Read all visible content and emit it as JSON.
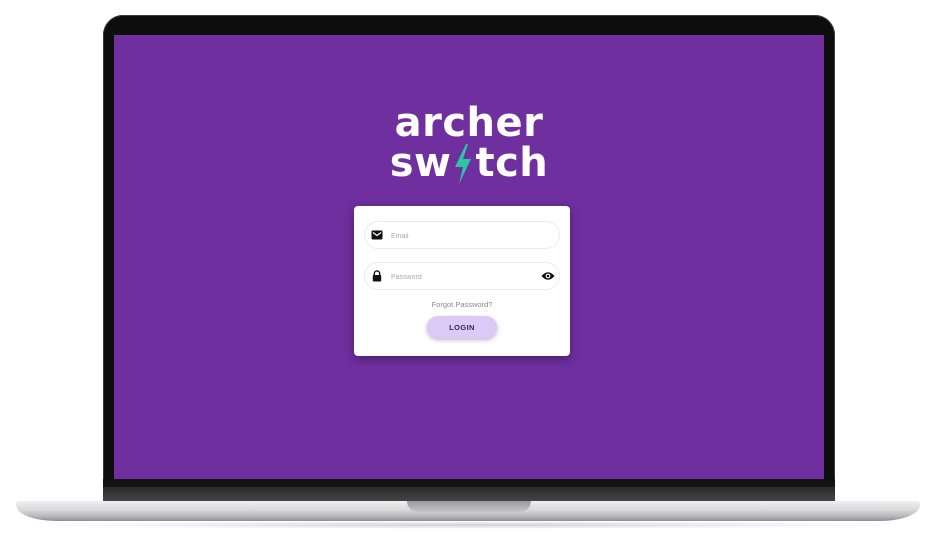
{
  "logo": {
    "line1": "archer",
    "line2_prefix": "sw",
    "line2_suffix": "tch",
    "bolt_color": "#2ec4a6",
    "text_color": "#ffffff"
  },
  "login": {
    "email": {
      "placeholder": "Email",
      "value": "",
      "icon": "envelope-icon"
    },
    "password": {
      "placeholder": "Password",
      "value": "",
      "icon": "lock-icon",
      "toggle_icon": "eye-icon"
    },
    "forgot_label": "Forgot Password?",
    "login_label": "LOGIN"
  },
  "colors": {
    "background": "#6f2f9f",
    "button": "#ddc9f6"
  }
}
